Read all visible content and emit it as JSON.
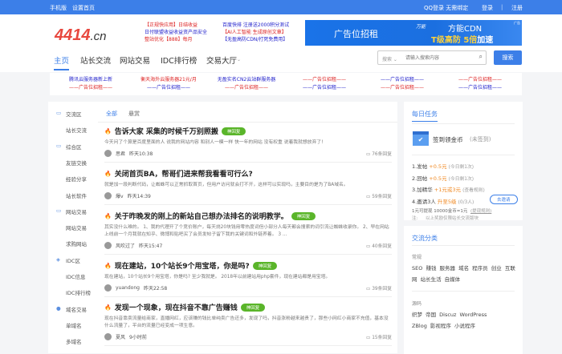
{
  "topbar": {
    "mobile": "手机版",
    "set_home": "设置首页",
    "qq_login": "QQ登录 无需绑定",
    "login": "登录",
    "sep": "|",
    "register": "注册"
  },
  "header": {
    "logo_main": "4414",
    "logo_suffix": ".cn",
    "ads_col1": [
      "【正规快应用】日结收益",
      "日付联盟收益收益资产品安全",
      "整站优化【888】每月"
    ],
    "ads_col2": [
      "百度快排 注册送2000积分测试",
      "【AI人工智能 生成原创文章】",
      "【无盈高防CDN/打死免费用】"
    ],
    "banner_left": "广告位招租",
    "banner_brand": "万能",
    "banner_title": "方能CDN",
    "banner_sub1": "T级高防",
    "banner_sub2": "5倍",
    "banner_sub3": "加速",
    "banner_tag": "广告"
  },
  "nav": {
    "items": [
      "主页",
      "站长交流",
      "网站交易",
      "IDC排行榜",
      "交易大厅"
    ],
    "search_scope": "搜索",
    "search_placeholder": "请输入搜索内容",
    "search_button": "搜索"
  },
  "adstrip": {
    "row1": [
      "腾讯云服务器新上新",
      "衡天海外云服务器21元/月",
      "无盈实名CN2云站群服务器",
      "——广告位招租——",
      "——广告位招租——",
      "——广告位招租——"
    ],
    "row2": [
      "——广告位招租——",
      "——广告位招租——",
      "——广告位招租——",
      "——广告位招租——",
      "——广告位招租——",
      "——广告位招租——"
    ]
  },
  "sidebar": [
    {
      "label": "交流区",
      "group": true
    },
    {
      "label": "站长交流"
    },
    {
      "label": "综合区",
      "group": true
    },
    {
      "label": "友链交换"
    },
    {
      "label": "经验分享"
    },
    {
      "label": "站长软件"
    },
    {
      "label": "网站交易",
      "group": true
    },
    {
      "label": "网站交易"
    },
    {
      "label": "求购网站"
    },
    {
      "label": "IDC区",
      "group": true
    },
    {
      "label": "IDC信息"
    },
    {
      "label": "IDC排行榜"
    },
    {
      "label": "域名交易",
      "group": true
    },
    {
      "label": "单域名"
    },
    {
      "label": "多域名"
    }
  ],
  "tabs": [
    "全部",
    "悬赏"
  ],
  "posts": [
    {
      "title": "告诉大家 采集的时候千万别照搬",
      "badge": "神回复",
      "desc": "今天问了个算是百度里面的人 说我的网站内容 和别人一模一样 快一年的网站 没有权重 说着我就想放弃了!",
      "author": "思君",
      "time": "昨天10:38",
      "replies": "76条回复"
    },
    {
      "title": "关闭首页BA，帮哥们进来帮我看看可行么?",
      "badge": "",
      "desc": "就是加一段判断代码，让蜘蛛可以正常抓取首页，但用户访问就会打不开，这样可以实现吗，主要目的是为了BA域名。",
      "author": "爆v",
      "time": "昨天14:39",
      "replies": "59条回复"
    },
    {
      "title": "关于昨晚发的刚上的新站自己想办法排名的说明教学。",
      "badge": "神回复",
      "desc": "其实没什么难的。 1、我的代理开了个竞价账户，每天烧20块钱用零热度词但小部分人每天都会搜索的词引流让蜘蛛收录你。 2、早在网站上线前一个月我就在知乎、微博和贴吧买了会员发帖子留下我的关键词和外链养着。 3 ...",
      "author": "风吹过了",
      "time": "昨天15:47",
      "replies": "40条回复"
    },
    {
      "title": "现在建站，10个站长9个用宝塔，你是吗?",
      "badge": "神回复",
      "desc": "现在建站，10个站长9个用宝塔，你是吗? 至少我就是。 2018年以前建站用php套件，现在建站都是用宝塔。",
      "author": "yuandong",
      "time": "昨天22:58",
      "replies": "39条回复"
    },
    {
      "title": "发现一个现象，现在抖音不靠广告赚钱",
      "badge": "神回复",
      "desc": "现在抖音靠卖流量给商家，直播网红，应该赚的钱比单纯卖广告还多，发现了吗，抖音涨粉越来越贵了，那些小网红小商家不充值，基本没什么流量了，平台的流量已经变成一项生意。",
      "author": "夏风",
      "time": "9小时前",
      "replies": "15条回复"
    }
  ],
  "daily": {
    "title": "每日任务",
    "checkin": "签到领金币",
    "checkin_status": "(未签到)",
    "tasks": [
      {
        "label": "1.发帖",
        "reward": "+0.5元",
        "note": "(今日剩1次)"
      },
      {
        "label": "2.回帖",
        "reward": "+0.5元",
        "note": "(今日剩1次)"
      },
      {
        "label": "3.加精华",
        "reward": "+1元或3元",
        "note": "(查看规则)"
      },
      {
        "label": "4.邀请3人",
        "reward": "升至5级",
        "note": "(0/3人)"
      }
    ],
    "invite_button": "去邀请",
    "withdraw": "1元可提现 10000金币=1元",
    "withdraw_rule": "(提现规则)",
    "note_label": "注:",
    "note": "以上奖励仅限站长交流版块"
  },
  "categories": {
    "title": "交流分类",
    "group1": "常规",
    "tags1": [
      "SEO",
      "赚钱",
      "服务器",
      "域名",
      "程序员",
      "创业",
      "互联网",
      "站长生活",
      "自媒体"
    ],
    "group2": "源码",
    "tags2": [
      "织梦",
      "帝国",
      "Discuz",
      "WordPress",
      "ZBlog",
      "影视程序",
      "小说程序"
    ]
  },
  "colors": {
    "primary": "#3c7fe8",
    "fire": "#ef5a2a",
    "badge": "#5ab52a",
    "reward": "#f08a24"
  }
}
